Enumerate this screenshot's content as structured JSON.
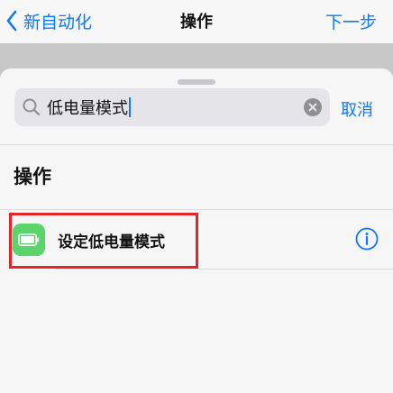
{
  "navbar": {
    "back_label": "新自动化",
    "title": "操作",
    "next_label": "下一步"
  },
  "search": {
    "value": "低电量模式",
    "cancel_label": "取消"
  },
  "section": {
    "title": "操作"
  },
  "actions": [
    {
      "label": "设定低电量模式",
      "icon": "battery-icon",
      "icon_bg": "#5bd46b"
    }
  ],
  "colors": {
    "accent": "#0a7aff",
    "highlight": "#e8242b"
  }
}
